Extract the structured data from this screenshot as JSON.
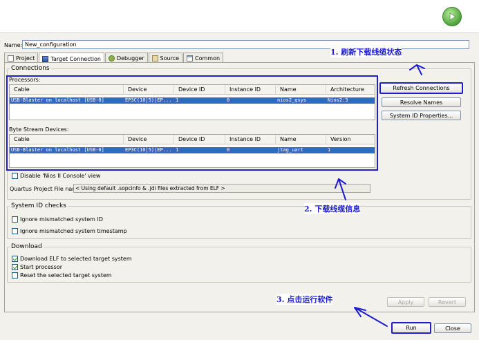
{
  "name_field": {
    "label": "Name:",
    "value": "New_configuration"
  },
  "tabs": [
    {
      "label": "Project",
      "icon": "project-icon"
    },
    {
      "label": "Target Connection",
      "icon": "target-connection-icon",
      "active": true
    },
    {
      "label": "Debugger",
      "icon": "debugger-icon"
    },
    {
      "label": "Source",
      "icon": "source-icon"
    },
    {
      "label": "Common",
      "icon": "common-icon"
    }
  ],
  "connections": {
    "title": "Connections",
    "processors": {
      "label": "Processors:",
      "headers": [
        "Cable",
        "Device",
        "Device ID",
        "Instance ID",
        "Name",
        "Architecture"
      ],
      "rows": [
        [
          "USB-Blaster on localhost [USB-0]",
          "EP3C(10|5)|EP...",
          "1",
          "0",
          "nios2_qsys",
          "Nios2:3"
        ]
      ]
    },
    "byte_stream": {
      "label": "Byte Stream Devices:",
      "headers": [
        "Cable",
        "Device",
        "Device ID",
        "Instance ID",
        "Name",
        "Version"
      ],
      "rows": [
        [
          "USB-Blaster on localhost [USB-0]",
          "EP3C(10|5)|EP...",
          "1",
          "0",
          "jtag_uart",
          "1"
        ]
      ]
    },
    "buttons": {
      "refresh": "Refresh Connections",
      "resolve": "Resolve Names",
      "sysid": "System ID Properties..."
    },
    "disable_console": {
      "label": "Disable 'Nios II Console' view",
      "checked": false
    },
    "quartus_file": {
      "label": "Quartus Project File name:",
      "value": "< Using default .sopcinfo & .jdi files extracted from ELF >"
    }
  },
  "sysid_checks": {
    "title": "System ID checks",
    "items": [
      {
        "label": "Ignore mismatched system ID",
        "checked": false
      },
      {
        "label": "Ignore mismatched system timestamp",
        "checked": false
      }
    ]
  },
  "download": {
    "title": "Download",
    "items": [
      {
        "label": "Download ELF to selected target system",
        "checked": true
      },
      {
        "label": "Start processor",
        "checked": true
      },
      {
        "label": "Reset the selected target system",
        "checked": false
      }
    ]
  },
  "actions": {
    "apply": "Apply",
    "revert": "Revert",
    "run": "Run",
    "close": "Close"
  },
  "annotations": {
    "a1": "1. 刷新下载线缆状态",
    "a2": "2. 下载线缆信息",
    "a3": "3. 点击运行软件"
  },
  "colors": {
    "selection": "#316ac5",
    "annotation": "#1a1ad0",
    "run_icon": "#4ea33a"
  }
}
